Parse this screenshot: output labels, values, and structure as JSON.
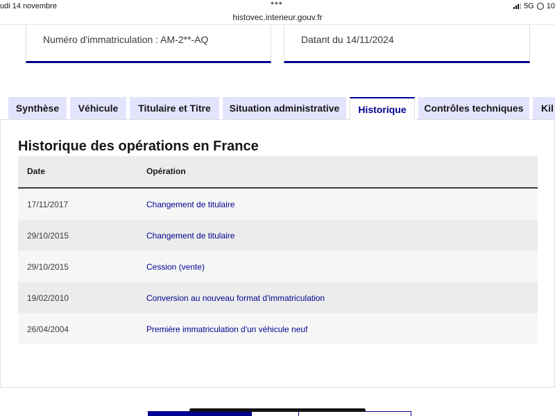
{
  "status": {
    "date": "udi 14 novembre",
    "network": "5G",
    "battery": "10",
    "url": "histovec.interieur.gouv.fr"
  },
  "cards": {
    "registration": "Numéro d'immatriculation : AM-2**-AQ",
    "date": "Datant du 14/11/2024"
  },
  "tabs": [
    {
      "label": "Synthèse"
    },
    {
      "label": "Véhicule"
    },
    {
      "label": "Titulaire et Titre"
    },
    {
      "label": "Situation administrative"
    },
    {
      "label": "Historique",
      "active": true
    },
    {
      "label": "Contrôles techniques"
    },
    {
      "label": "Kil"
    }
  ],
  "section": {
    "title": "Historique des opérations en France"
  },
  "table": {
    "headers": {
      "date": "Date",
      "operation": "Opération"
    },
    "rows": [
      {
        "date": "17/11/2017",
        "operation": "Changement de titulaire"
      },
      {
        "date": "29/10/2015",
        "operation": "Changement de titulaire"
      },
      {
        "date": "29/10/2015",
        "operation": "Cession (vente)"
      },
      {
        "date": "19/02/2010",
        "operation": "Conversion au nouveau format d'immatriculation"
      },
      {
        "date": "26/04/2004",
        "operation": "Première immatriculation d'un véhicule neuf"
      }
    ]
  },
  "colors": {
    "accent": "#000091",
    "tab_bg": "#e3e3fd",
    "row_alt": "#ececec"
  },
  "icons": [
    "signal-icon",
    "location-icon",
    "more-dots-icon"
  ]
}
